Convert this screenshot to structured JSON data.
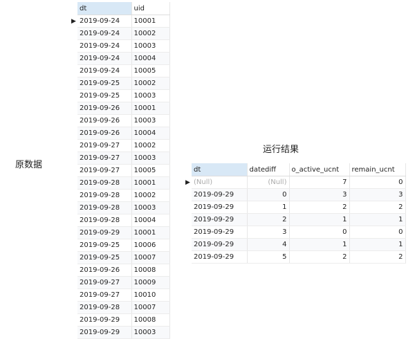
{
  "labels": {
    "source": "原数据",
    "result": "运行结果"
  },
  "source_table": {
    "columns": [
      "dt",
      "uid"
    ],
    "rows": [
      [
        "2019-09-24",
        "10001"
      ],
      [
        "2019-09-24",
        "10002"
      ],
      [
        "2019-09-24",
        "10003"
      ],
      [
        "2019-09-24",
        "10004"
      ],
      [
        "2019-09-24",
        "10005"
      ],
      [
        "2019-09-25",
        "10002"
      ],
      [
        "2019-09-25",
        "10003"
      ],
      [
        "2019-09-26",
        "10001"
      ],
      [
        "2019-09-26",
        "10003"
      ],
      [
        "2019-09-26",
        "10004"
      ],
      [
        "2019-09-27",
        "10002"
      ],
      [
        "2019-09-27",
        "10003"
      ],
      [
        "2019-09-27",
        "10005"
      ],
      [
        "2019-09-28",
        "10001"
      ],
      [
        "2019-09-28",
        "10002"
      ],
      [
        "2019-09-28",
        "10003"
      ],
      [
        "2019-09-28",
        "10004"
      ],
      [
        "2019-09-29",
        "10001"
      ],
      [
        "2019-09-25",
        "10006"
      ],
      [
        "2019-09-25",
        "10007"
      ],
      [
        "2019-09-26",
        "10008"
      ],
      [
        "2019-09-27",
        "10009"
      ],
      [
        "2019-09-27",
        "10010"
      ],
      [
        "2019-09-28",
        "10007"
      ],
      [
        "2019-09-29",
        "10008"
      ],
      [
        "2019-09-29",
        "10003"
      ]
    ]
  },
  "result_table": {
    "columns": [
      "dt",
      "datediff",
      "o_active_ucnt",
      "remain_ucnt"
    ],
    "rows": [
      [
        "(Null)",
        "(Null)",
        "7",
        "0"
      ],
      [
        "2019-09-29",
        "0",
        "3",
        "3"
      ],
      [
        "2019-09-29",
        "1",
        "2",
        "2"
      ],
      [
        "2019-09-29",
        "2",
        "1",
        "1"
      ],
      [
        "2019-09-29",
        "3",
        "0",
        "0"
      ],
      [
        "2019-09-29",
        "4",
        "1",
        "1"
      ],
      [
        "2019-09-29",
        "5",
        "2",
        "2"
      ]
    ]
  },
  "icons": {
    "row_indicator": "▶"
  }
}
